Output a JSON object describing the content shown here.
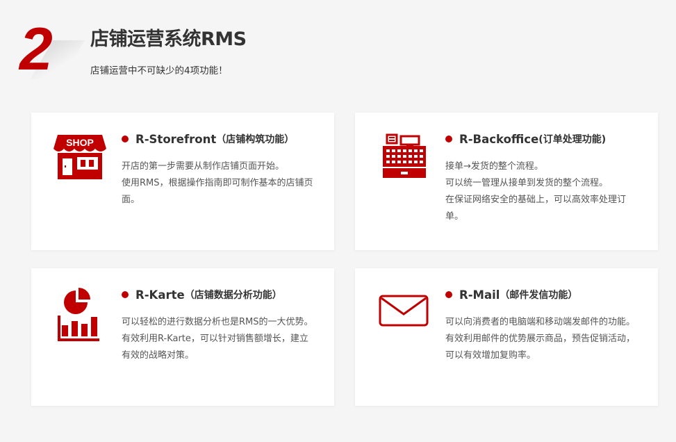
{
  "header": {
    "section_number": "2",
    "title": "店铺运营系统RMS",
    "subtitle": "店铺运营中不可缺少的4项功能！"
  },
  "colors": {
    "accent": "#c00000",
    "background": "#f5f5f5",
    "card": "#ffffff"
  },
  "cards": [
    {
      "icon": "shop-icon",
      "icon_text": "SHOP",
      "title": "R-Storefront",
      "title_sub": "（店铺构筑功能）",
      "lines": [
        "开店的第一步需要从制作店铺页面开始。",
        "使用RMS，根据操作指南即可制作基本的店铺页面。"
      ]
    },
    {
      "icon": "cash-register-icon",
      "title": "R-Backoffice",
      "title_sub": "(订单处理功能)",
      "lines": [
        "接单→发货的整个流程。",
        "可以统一管理从接单到发货的整个流程。",
        "在保证网络安全的基础上，可以高效率处理订单。"
      ]
    },
    {
      "icon": "analytics-chart-icon",
      "title": "R-Karte",
      "title_sub": "（店铺数据分析功能）",
      "lines": [
        "可以轻松的进行数据分析也是RMS的一大优势。有效利用R-Karte，可以针对销售额增长，建立有效的战略对策。"
      ]
    },
    {
      "icon": "mail-envelope-icon",
      "title": "R-Mail",
      "title_sub": "（邮件发信功能）",
      "lines": [
        "可以向消费者的电脑端和移动端发邮件的功能。有效利用邮件的优势展示商品，预告促销活动，可以有效增加复购率。"
      ]
    }
  ]
}
